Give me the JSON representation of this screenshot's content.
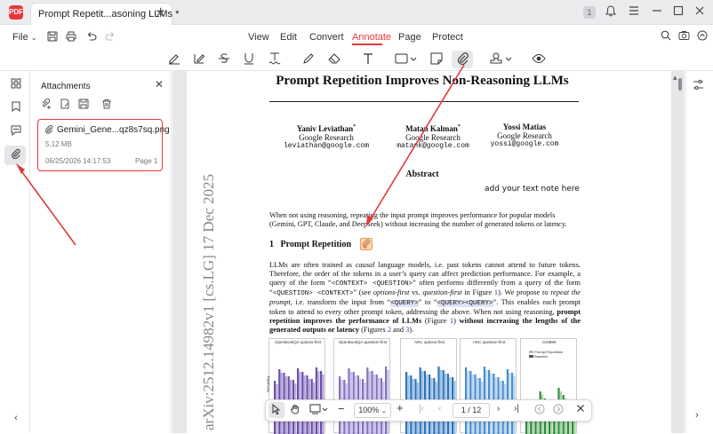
{
  "titlebar": {
    "tab_title": "Prompt Repetit...asoning LLMs *",
    "logo_text": "PDF",
    "page_badge": "1",
    "icons": [
      "plus-icon",
      "bell-icon",
      "menu-icon",
      "minimize-icon",
      "maximize-icon",
      "close-icon"
    ]
  },
  "menubar": {
    "file_label": "File",
    "tabs": [
      "View",
      "Edit",
      "Convert",
      "Annotate",
      "Page",
      "Protect"
    ],
    "active_tab": "Annotate",
    "accent_color": "#e8363d"
  },
  "tools": [
    "highlight-icon",
    "text-edit-icon",
    "strikethrough-icon",
    "underline-icon",
    "squiggly-icon",
    "pencil-icon",
    "eraser-icon",
    "text-box-icon",
    "shape-icon",
    "sticky-note-icon",
    "attachment-icon",
    "stamp-icon",
    "eye-icon"
  ],
  "panel": {
    "title": "Attachments",
    "attachment": {
      "name": "Gemini_Gene...qz8s7sq.png",
      "size": "5.12 MB",
      "date": "06/25/2026 14:17:53",
      "page": "Page 1"
    }
  },
  "paper": {
    "title": "Prompt Repetition Improves Non-Reasoning LLMs",
    "authors": [
      {
        "name": "Yaniv Leviathan",
        "mark": "*",
        "affiliation": "Google Research",
        "email": "leviathan@google.com"
      },
      {
        "name": "Matan Kalman",
        "mark": "*",
        "affiliation": "Google Research",
        "email": "matank@google.com"
      },
      {
        "name": "Yossi Matias",
        "mark": "",
        "affiliation": "Google Research",
        "email": "yossi@google.com"
      }
    ],
    "abstract_heading": "Abstract",
    "note_text": "add your text note here",
    "abstract_text": "When not using reasoning, repeating the input prompt improves performance for popular models (Gemini, GPT, Claude, and Deepseek) without increasing the number of generated tokens or latency.",
    "section_number": "1",
    "section_title": "Prompt Repetition",
    "body": {
      "p1": "LLMs are often trained as ",
      "p1_em": "causal",
      "p2": " language models, i.e. past tokens cannot attend to future tokens. Therefore, the order of the tokens in a user’s query can affect prediction performance. For example, a query of the form “",
      "ctx_q": "<CONTEXT> <QUESTION>",
      "p3": "” often performs differently from a query of the form “",
      "q_ctx": "<QUESTION> <CONTEXT>",
      "p4": "” (see ",
      "em_options": "options-first",
      "p5": " vs. ",
      "em_question": "question-first",
      "p6": " in Figure ",
      "fig1": "1",
      "p7": "). We propose to ",
      "em_repeat": "repeat the prompt",
      "p8": ", i.e. transform the input from “",
      "query1": "<QUERY>",
      "p9": "” to “",
      "query2": "<QUERY><QUERY>",
      "p10": "”. This enables each prompt token to attend to every other prompt token, addressing the above. When not using reasoning, ",
      "bold1": "prompt repetition improves the performance of LLMs",
      "p11": " (Figure ",
      "fig1b": "1",
      "p12": ") ",
      "bold2": "without increasing the lengths of the generated outputs or latency",
      "p13": " (Figures ",
      "fig2": "2",
      "p14": " and ",
      "fig3": "3",
      "p15": ")."
    },
    "arxiv_stamp": "arXiv:2512.14982v1  [cs.LG]  17 Dec 2025",
    "figure_titles": [
      "OpenBookQA options-first",
      "OpenBookQA question-first",
      "ARC options-first",
      "ARC question-first",
      "GSM8K"
    ],
    "figure_ylabel": "Accuracy",
    "legend": [
      "Prompt Repetition",
      "Baseline"
    ]
  },
  "bottombar": {
    "zoom": "100%",
    "page_current": "1",
    "page_total": "/ 12"
  }
}
